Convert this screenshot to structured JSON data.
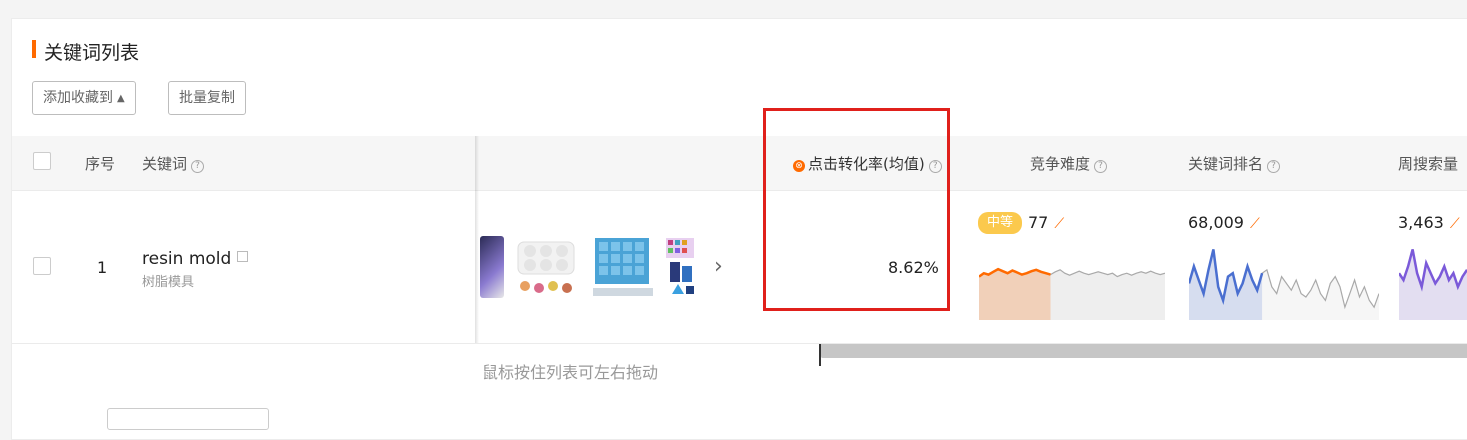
{
  "section": {
    "title": "关键词列表",
    "add_favorite_label": "添加收藏到",
    "batch_copy_label": "批量复制"
  },
  "table": {
    "headers": {
      "index": "序号",
      "keyword": "关键词",
      "click_conversion": "点击转化率(均值)",
      "competition": "竞争难度",
      "keyword_rank": "关键词排名",
      "weekly_search": "周搜索量"
    },
    "rows": [
      {
        "index": "1",
        "keyword": "resin mold",
        "keyword_translation": "树脂模具",
        "click_conversion": "8.62%",
        "competition_level": "中等",
        "competition_score": "77",
        "keyword_rank": "68,009",
        "weekly_search": "3,463"
      }
    ],
    "drag_hint": "鼠标按住列表可左右拖动"
  },
  "colors": {
    "accent": "#ff6a00",
    "highlight_box": "#e0201b",
    "badge": "#fbc94d",
    "rank_line": "#4a6fd0",
    "search_line": "#7b5ad9"
  },
  "sparklines": {
    "competition": [
      0.55,
      0.6,
      0.58,
      0.62,
      0.66,
      0.63,
      0.6,
      0.64,
      0.61,
      0.58,
      0.6,
      0.63,
      0.65,
      0.62,
      0.6,
      0.58,
      0.62,
      0.65,
      0.6,
      0.57,
      0.6,
      0.63,
      0.6,
      0.58,
      0.6,
      0.62,
      0.6,
      0.58,
      0.6,
      0.55,
      0.58,
      0.6,
      0.57,
      0.6,
      0.62,
      0.6,
      0.63,
      0.6,
      0.58,
      0.6
    ],
    "competition_highlight_count": 16,
    "rank": [
      0.45,
      0.7,
      0.5,
      0.3,
      0.65,
      0.95,
      0.4,
      0.2,
      0.55,
      0.6,
      0.3,
      0.45,
      0.7,
      0.5,
      0.35,
      0.6,
      0.65,
      0.4,
      0.3,
      0.55,
      0.45,
      0.35,
      0.5,
      0.3,
      0.25,
      0.35,
      0.5,
      0.3,
      0.2,
      0.45,
      0.55,
      0.4,
      0.1,
      0.3,
      0.5,
      0.25,
      0.4,
      0.2,
      0.1,
      0.3
    ],
    "rank_highlight_count": 16,
    "weekly_search": [
      0.6,
      0.5,
      0.7,
      0.95,
      0.6,
      0.4,
      0.75,
      0.6,
      0.45,
      0.55,
      0.7,
      0.5,
      0.6,
      0.4,
      0.55,
      0.65
    ]
  }
}
